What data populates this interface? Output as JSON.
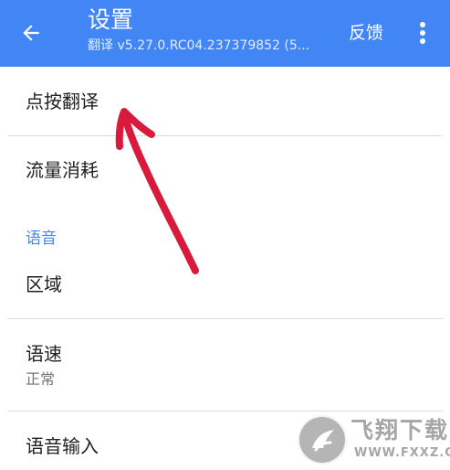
{
  "appbar": {
    "title": "设置",
    "subtitle": "翻译 v5.27.0.RC04.237379852 (5...",
    "feedback_label": "反馈",
    "background_color": "#4285f4",
    "back_icon": "arrow-left-icon",
    "menu_icon": "more-vert-icon"
  },
  "list": {
    "tap_to_translate": "点按翻译",
    "data_usage": "流量消耗",
    "voice_section_header": "语音",
    "region": "区域",
    "speech_rate": {
      "title": "语速",
      "value": "正常"
    },
    "voice_input": "语音输入"
  },
  "annotation": {
    "color": "#d81b3c",
    "shape": "hand-drawn-arrow"
  },
  "watermark": {
    "cn": "飞翔下载",
    "en": "WWW.FXXZ.COM"
  }
}
